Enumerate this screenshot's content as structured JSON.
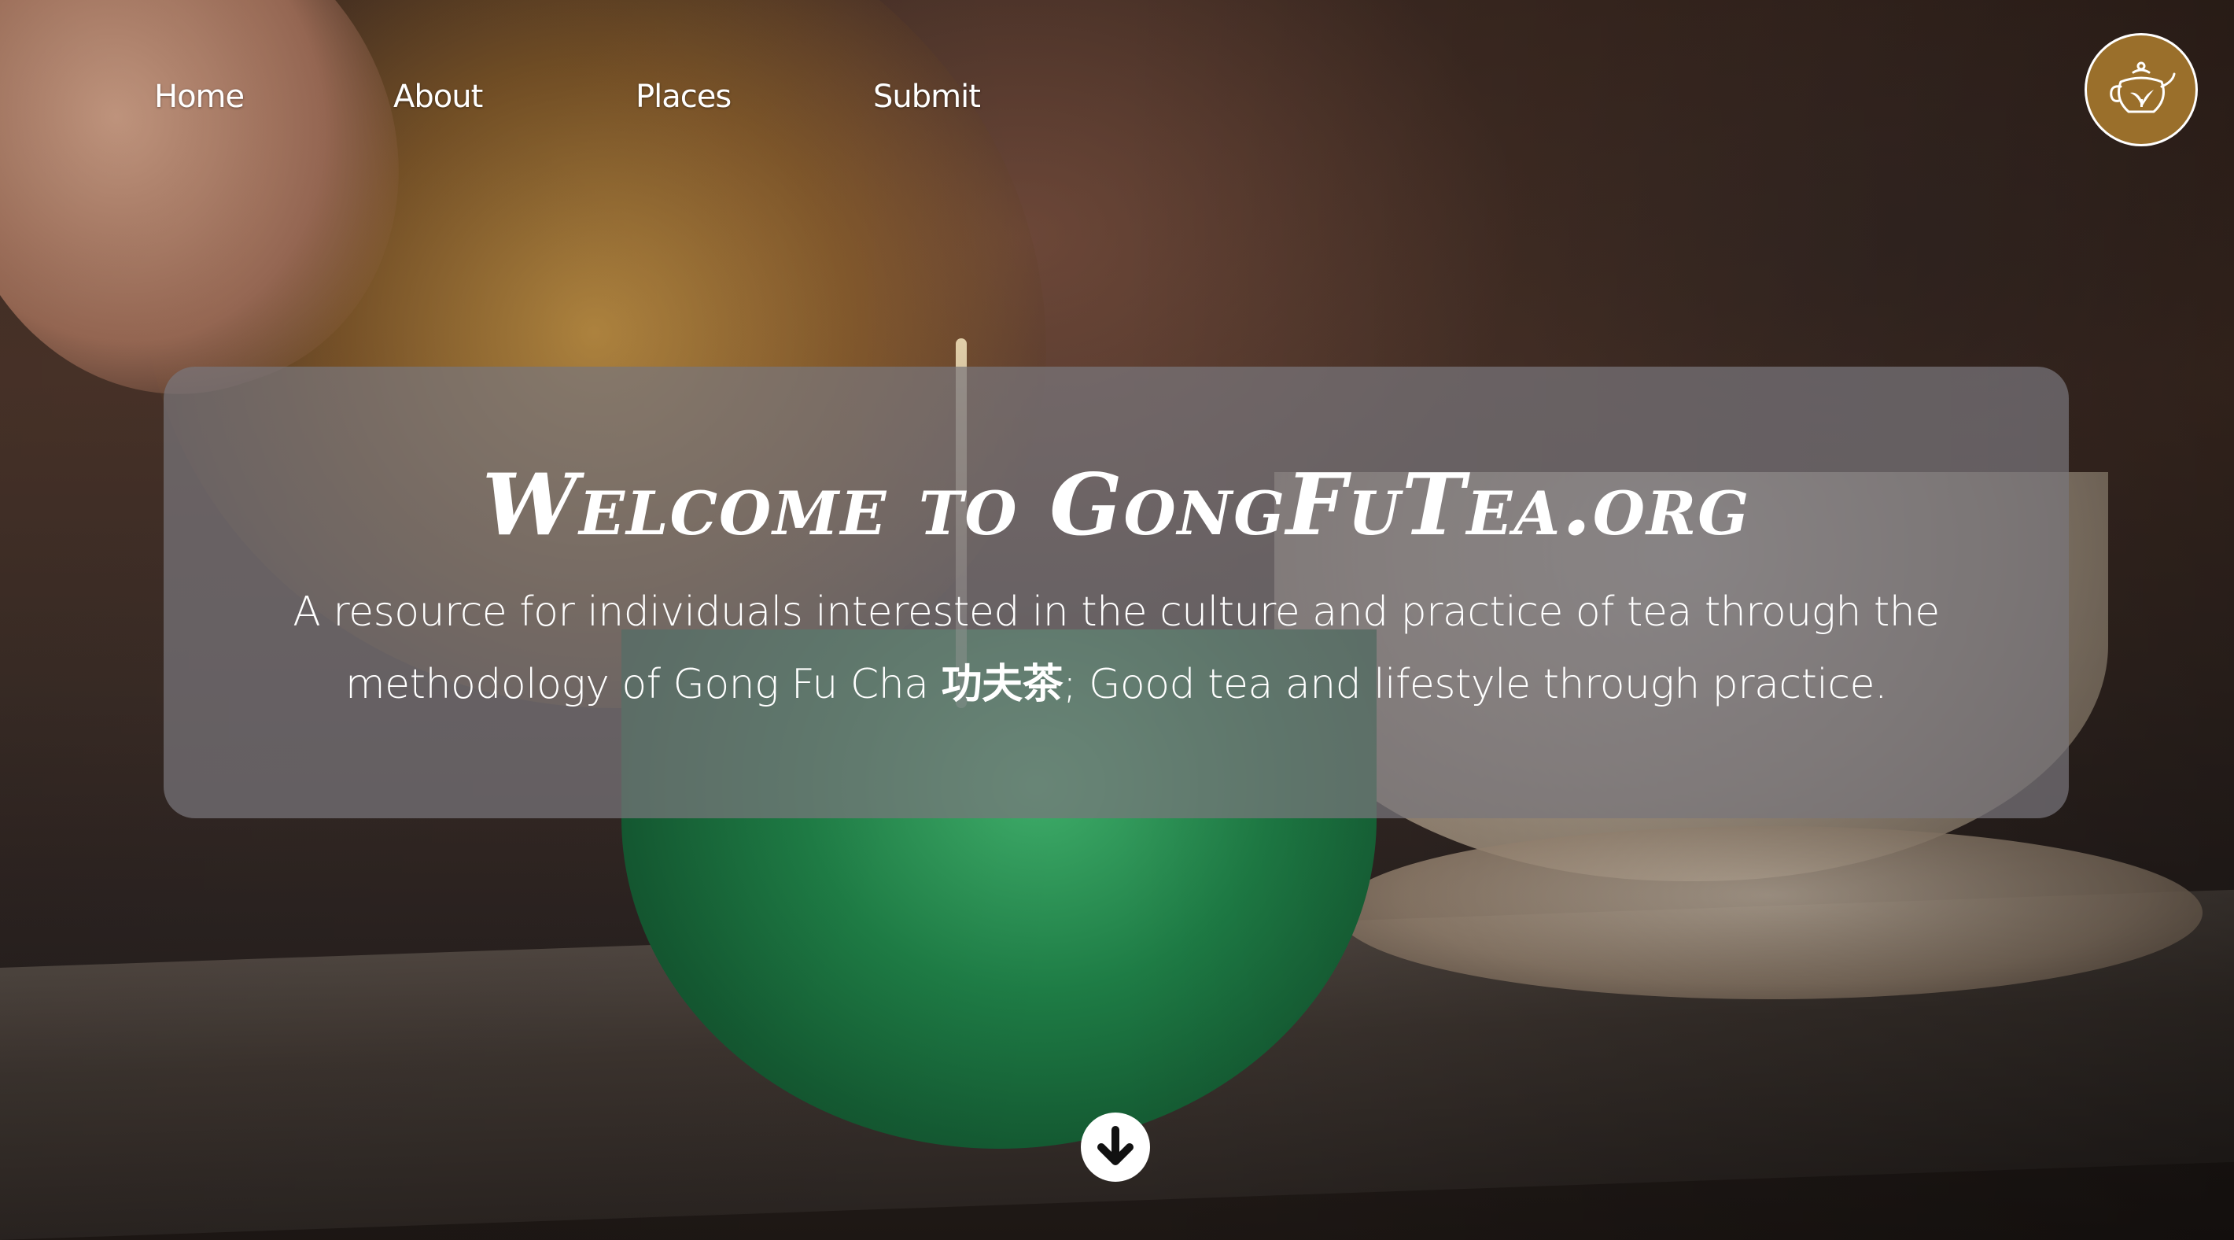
{
  "nav": {
    "items": [
      {
        "label": "Home"
      },
      {
        "label": "About"
      },
      {
        "label": "Places"
      },
      {
        "label": "Submit"
      }
    ],
    "logo_icon": "teapot-icon",
    "logo_color": "#9a6f2b"
  },
  "hero": {
    "title": "Welcome to GongFuTea.org",
    "text_before": "A resource for individuals interested in the culture and practice of tea through the methodology of Gong Fu Cha ",
    "text_cjk": "功夫茶",
    "text_after": "; Good tea and lifestyle through practice."
  },
  "scroll_icon": "arrow-down-circle-icon"
}
